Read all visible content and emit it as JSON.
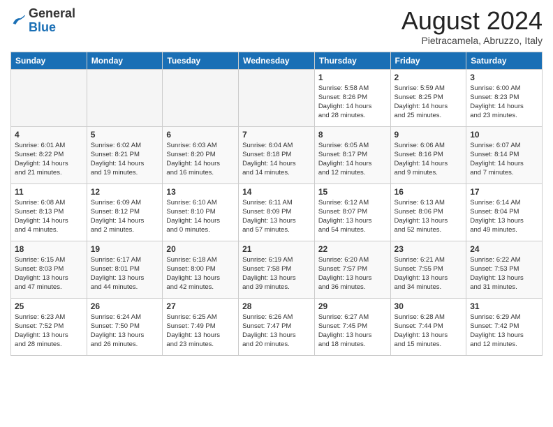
{
  "header": {
    "logo": {
      "general": "General",
      "blue": "Blue"
    },
    "title": "August 2024",
    "location": "Pietracamela, Abruzzo, Italy"
  },
  "weekdays": [
    "Sunday",
    "Monday",
    "Tuesday",
    "Wednesday",
    "Thursday",
    "Friday",
    "Saturday"
  ],
  "weeks": [
    [
      {
        "day": "",
        "info": ""
      },
      {
        "day": "",
        "info": ""
      },
      {
        "day": "",
        "info": ""
      },
      {
        "day": "",
        "info": ""
      },
      {
        "day": "1",
        "info": "Sunrise: 5:58 AM\nSunset: 8:26 PM\nDaylight: 14 hours\nand 28 minutes."
      },
      {
        "day": "2",
        "info": "Sunrise: 5:59 AM\nSunset: 8:25 PM\nDaylight: 14 hours\nand 25 minutes."
      },
      {
        "day": "3",
        "info": "Sunrise: 6:00 AM\nSunset: 8:23 PM\nDaylight: 14 hours\nand 23 minutes."
      }
    ],
    [
      {
        "day": "4",
        "info": "Sunrise: 6:01 AM\nSunset: 8:22 PM\nDaylight: 14 hours\nand 21 minutes."
      },
      {
        "day": "5",
        "info": "Sunrise: 6:02 AM\nSunset: 8:21 PM\nDaylight: 14 hours\nand 19 minutes."
      },
      {
        "day": "6",
        "info": "Sunrise: 6:03 AM\nSunset: 8:20 PM\nDaylight: 14 hours\nand 16 minutes."
      },
      {
        "day": "7",
        "info": "Sunrise: 6:04 AM\nSunset: 8:18 PM\nDaylight: 14 hours\nand 14 minutes."
      },
      {
        "day": "8",
        "info": "Sunrise: 6:05 AM\nSunset: 8:17 PM\nDaylight: 14 hours\nand 12 minutes."
      },
      {
        "day": "9",
        "info": "Sunrise: 6:06 AM\nSunset: 8:16 PM\nDaylight: 14 hours\nand 9 minutes."
      },
      {
        "day": "10",
        "info": "Sunrise: 6:07 AM\nSunset: 8:14 PM\nDaylight: 14 hours\nand 7 minutes."
      }
    ],
    [
      {
        "day": "11",
        "info": "Sunrise: 6:08 AM\nSunset: 8:13 PM\nDaylight: 14 hours\nand 4 minutes."
      },
      {
        "day": "12",
        "info": "Sunrise: 6:09 AM\nSunset: 8:12 PM\nDaylight: 14 hours\nand 2 minutes."
      },
      {
        "day": "13",
        "info": "Sunrise: 6:10 AM\nSunset: 8:10 PM\nDaylight: 14 hours\nand 0 minutes."
      },
      {
        "day": "14",
        "info": "Sunrise: 6:11 AM\nSunset: 8:09 PM\nDaylight: 13 hours\nand 57 minutes."
      },
      {
        "day": "15",
        "info": "Sunrise: 6:12 AM\nSunset: 8:07 PM\nDaylight: 13 hours\nand 54 minutes."
      },
      {
        "day": "16",
        "info": "Sunrise: 6:13 AM\nSunset: 8:06 PM\nDaylight: 13 hours\nand 52 minutes."
      },
      {
        "day": "17",
        "info": "Sunrise: 6:14 AM\nSunset: 8:04 PM\nDaylight: 13 hours\nand 49 minutes."
      }
    ],
    [
      {
        "day": "18",
        "info": "Sunrise: 6:15 AM\nSunset: 8:03 PM\nDaylight: 13 hours\nand 47 minutes."
      },
      {
        "day": "19",
        "info": "Sunrise: 6:17 AM\nSunset: 8:01 PM\nDaylight: 13 hours\nand 44 minutes."
      },
      {
        "day": "20",
        "info": "Sunrise: 6:18 AM\nSunset: 8:00 PM\nDaylight: 13 hours\nand 42 minutes."
      },
      {
        "day": "21",
        "info": "Sunrise: 6:19 AM\nSunset: 7:58 PM\nDaylight: 13 hours\nand 39 minutes."
      },
      {
        "day": "22",
        "info": "Sunrise: 6:20 AM\nSunset: 7:57 PM\nDaylight: 13 hours\nand 36 minutes."
      },
      {
        "day": "23",
        "info": "Sunrise: 6:21 AM\nSunset: 7:55 PM\nDaylight: 13 hours\nand 34 minutes."
      },
      {
        "day": "24",
        "info": "Sunrise: 6:22 AM\nSunset: 7:53 PM\nDaylight: 13 hours\nand 31 minutes."
      }
    ],
    [
      {
        "day": "25",
        "info": "Sunrise: 6:23 AM\nSunset: 7:52 PM\nDaylight: 13 hours\nand 28 minutes."
      },
      {
        "day": "26",
        "info": "Sunrise: 6:24 AM\nSunset: 7:50 PM\nDaylight: 13 hours\nand 26 minutes."
      },
      {
        "day": "27",
        "info": "Sunrise: 6:25 AM\nSunset: 7:49 PM\nDaylight: 13 hours\nand 23 minutes."
      },
      {
        "day": "28",
        "info": "Sunrise: 6:26 AM\nSunset: 7:47 PM\nDaylight: 13 hours\nand 20 minutes."
      },
      {
        "day": "29",
        "info": "Sunrise: 6:27 AM\nSunset: 7:45 PM\nDaylight: 13 hours\nand 18 minutes."
      },
      {
        "day": "30",
        "info": "Sunrise: 6:28 AM\nSunset: 7:44 PM\nDaylight: 13 hours\nand 15 minutes."
      },
      {
        "day": "31",
        "info": "Sunrise: 6:29 AM\nSunset: 7:42 PM\nDaylight: 13 hours\nand 12 minutes."
      }
    ]
  ]
}
